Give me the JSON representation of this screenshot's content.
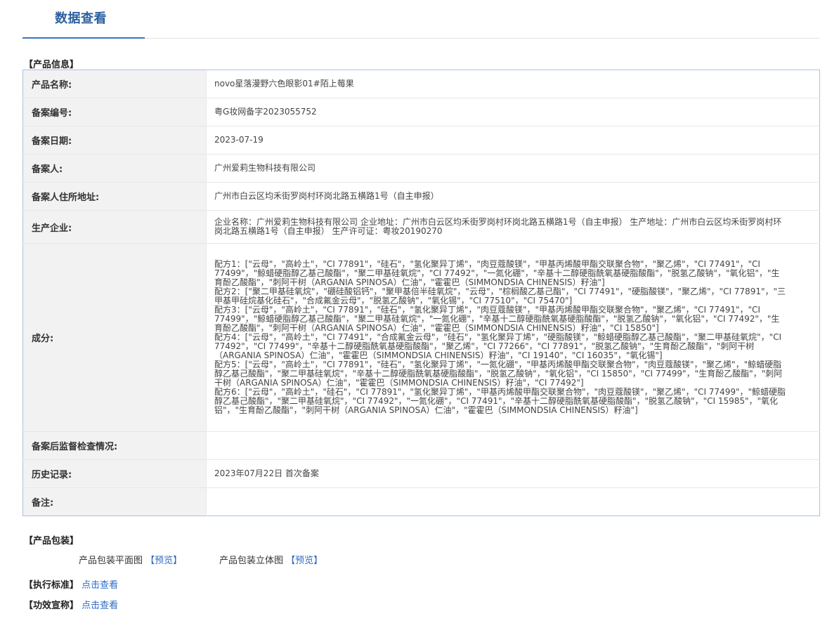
{
  "header": {
    "tab_label": "数据查看"
  },
  "product_info": {
    "section_title": "【产品信息】",
    "rows": [
      {
        "label": "产品名称:",
        "value": "novo星落漫野六色眼影01#陌上莓果"
      },
      {
        "label": "备案编号:",
        "value": "粤G妆网备字2023055752"
      },
      {
        "label": "备案日期:",
        "value": "2023-07-19"
      },
      {
        "label": "备案人:",
        "value": "广州爱莉生物科技有限公司"
      },
      {
        "label": "备案人住所地址:",
        "value": "广州市白云区均禾街罗岗村环岗北路五横路1号（自主申报）"
      },
      {
        "label": "生产企业:",
        "value": "企业名称：广州爱莉生物科技有限公司 企业地址：广州市白云区均禾街罗岗村环岗北路五横路1号（自主申报） 生产地址：广州市白云区均禾街罗岗村环岗北路五横路1号（自主申报） 生产许可证：粤妆20190270"
      },
      {
        "label": "成分:",
        "value": "配方1：[\"云母\"，\"高岭土\"，\"CI 77891\"，\"硅石\"，\"氢化聚异丁烯\"，\"肉豆蔻酸镁\"，\"甲基丙烯酸甲酯交联聚合物\"，\"聚乙烯\"，\"CI 77491\"，\"CI 77499\"，\"鲸蜡硬脂醇乙基己酸酯\"，\"聚二甲基硅氧烷\"，\"CI 77492\"，\"一氮化硼\"，\"辛基十二醇硬脂酰氧基硬脂酸酯\"，\"脱氢乙酸钠\"，\"氧化铝\"，\"生育酚乙酸酯\"，\"刺阿干树（ARGANIA SPINOSA）仁油\"，\"霍霍巴（SIMMONDSIA CHINENSIS）籽油\"]\n配方2：[\"聚二甲基硅氧烷\"，\"硼硅酸铝钙\"，\"聚甲基倍半硅氧烷\"，\"云母\"，\"棕榈酸乙基己酯\"，\"CI 77491\"，\"硬脂酸镁\"，\"聚乙烯\"，\"CI 77891\"，\"三甲基甲硅烷基化硅石\"，\"合成氟金云母\"，\"脱氢乙酸钠\"，\"氧化锡\"，\"CI 77510\"，\"CI 75470\"]\n配方3：[\"云母\"，\"高岭土\"，\"CI 77891\"，\"硅石\"，\"氢化聚异丁烯\"，\"肉豆蔻酸镁\"，\"甲基丙烯酸甲酯交联聚合物\"，\"聚乙烯\"，\"CI 77491\"，\"CI 77499\"，\"鲸蜡硬脂醇乙基己酸酯\"，\"聚二甲基硅氧烷\"，\"一氮化硼\"，\"辛基十二醇硬脂酰氧基硬脂酸酯\"，\"脱氢乙酸钠\"，\"氧化铝\"，\"CI 77492\"，\"生育酚乙酸酯\"，\"刺阿干树（ARGANIA SPINOSA）仁油\"，\"霍霍巴（SIMMONDSIA CHINENSIS）籽油\"，\"CI 15850\"]\n配方4：[\"云母\"，\"高岭土\"，\"CI 77491\"，\"合成氟金云母\"，\"硅石\"，\"氢化聚异丁烯\"，\"硬脂酸镁\"，\"鲸蜡硬脂醇乙基己酸酯\"，\"聚二甲基硅氧烷\"，\"CI 77492\"，\"CI 77499\"，\"辛基十二醇硬脂酰氧基硬脂酸酯\"，\"聚乙烯\"，\"CI 77266\"，\"CI 77891\"，\"脱氢乙酸钠\"，\"生育酚乙酸酯\"，\"刺阿干树（ARGANIA SPINOSA）仁油\"，\"霍霍巴（SIMMONDSIA CHINENSIS）籽油\"，\"CI 19140\"，\"CI 16035\"，\"氧化锡\"]\n配方5：[\"云母\"，\"高岭土\"，\"CI 77891\"，\"硅石\"，\"氢化聚异丁烯\"，\"一氮化硼\"，\"甲基丙烯酸甲酯交联聚合物\"，\"肉豆蔻酸镁\"，\"聚乙烯\"，\"鲸蜡硬脂醇乙基己酸酯\"，\"聚二甲基硅氧烷\"，\"辛基十二醇硬脂酰氧基硬脂酸酯\"，\"脱氢乙酸钠\"，\"氧化铝\"，\"CI 15850\"，\"CI 77499\"，\"生育酚乙酸酯\"，\"刺阿干树（ARGANIA SPINOSA）仁油\"，\"霍霍巴（SIMMONDSIA CHINENSIS）籽油\"，\"CI 77492\"]\n配方6：[\"云母\"，\"高岭土\"，\"硅石\"，\"CI 77891\"，\"氢化聚异丁烯\"，\"甲基丙烯酸甲酯交联聚合物\"，\"肉豆蔻酸镁\"，\"聚乙烯\"，\"CI 77499\"，\"鲸蜡硬脂醇乙基己酸酯\"，\"聚二甲基硅氧烷\"，\"CI 77492\"，\"一氮化硼\"，\"CI 77491\"，\"辛基十二醇硬脂酰氧基硬脂酸酯\"，\"脱氢乙酸钠\"，\"CI 15985\"，\"氧化铝\"，\"生育酚乙酸酯\"，\"刺阿干树（ARGANIA SPINOSA）仁油\"，\"霍霍巴（SIMMONDSIA CHINENSIS）籽油\"]"
      },
      {
        "label": "备案后监督检查情况:",
        "value": ""
      },
      {
        "label": "历史记录:",
        "value": "2023年07月22日 首次备案"
      },
      {
        "label": "备注:",
        "value": ""
      }
    ]
  },
  "packaging": {
    "section_title": "【产品包装】",
    "flat_label": "产品包装平面图",
    "flat_link": "【预览】",
    "solid_label": "产品包装立体图",
    "solid_link": "【预览】"
  },
  "standard": {
    "title": "【执行标准】",
    "link": "点击查看"
  },
  "efficacy": {
    "title": "【功效宣称】",
    "link": "点击查看"
  }
}
